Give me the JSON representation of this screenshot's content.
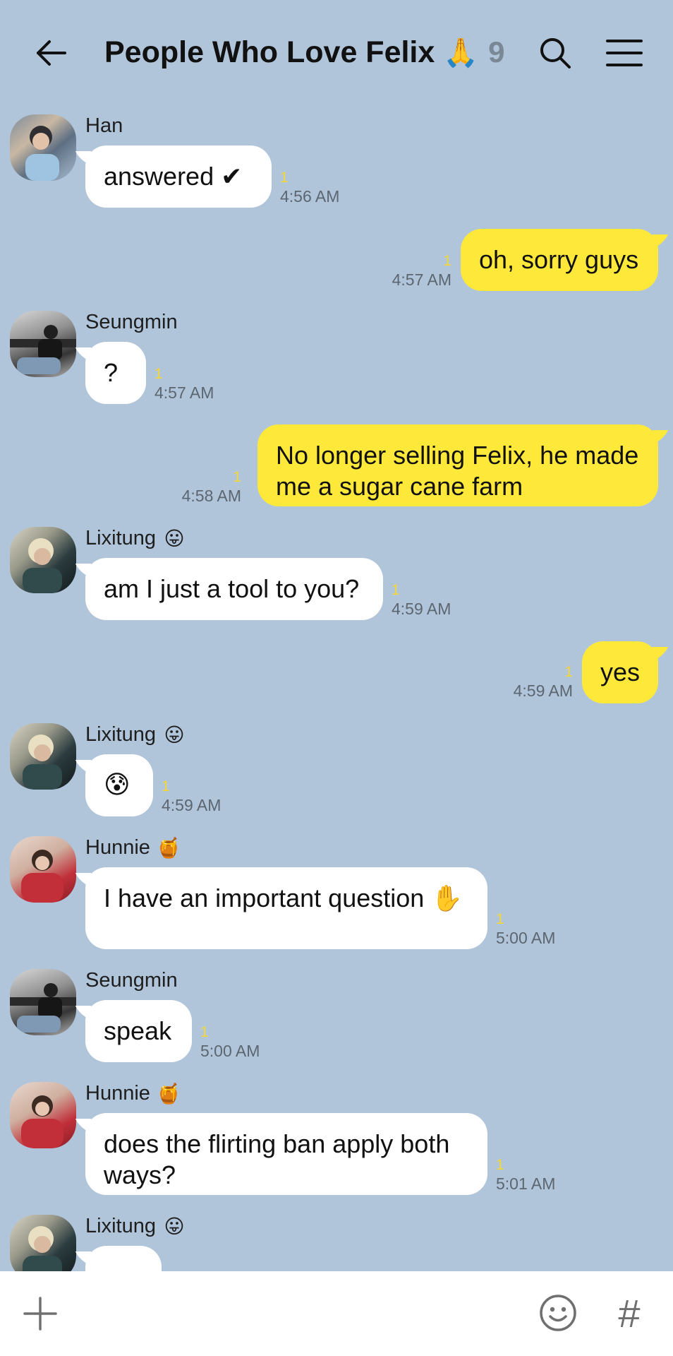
{
  "header": {
    "title": "People Who Love Felix",
    "title_emoji": "🙏",
    "member_count": "9",
    "icons": [
      "back-arrow-icon",
      "search-icon",
      "hamburger-menu-icon"
    ]
  },
  "messages": [
    {
      "sender": "Han",
      "sender_emoji": "",
      "text": "answered ✔",
      "unread": "1",
      "time": "4:56 AM",
      "direction": "in"
    },
    {
      "sender": "",
      "text": "oh, sorry guys",
      "unread": "1",
      "time": "4:57 AM",
      "direction": "out"
    },
    {
      "sender": "Seungmin",
      "sender_emoji": "",
      "text": "?",
      "unread": "1",
      "time": "4:57 AM",
      "direction": "in"
    },
    {
      "sender": "",
      "text": "No longer selling Felix, he made me a sugar cane farm",
      "unread": "1",
      "time": "4:58 AM",
      "direction": "out"
    },
    {
      "sender": "Lixitung",
      "sender_emoji": "😛",
      "text": "am I just a tool to you?",
      "unread": "1",
      "time": "4:59 AM",
      "direction": "in"
    },
    {
      "sender": "",
      "text": "yes",
      "unread": "1",
      "time": "4:59 AM",
      "direction": "out"
    },
    {
      "sender": "Lixitung",
      "sender_emoji": "😛",
      "text": "😰",
      "unread": "1",
      "time": "4:59 AM",
      "direction": "in"
    },
    {
      "sender": "Hunnie",
      "sender_emoji": "🍯",
      "text": "I have an important question ✋",
      "unread": "1",
      "time": "5:00 AM",
      "direction": "in"
    },
    {
      "sender": "Seungmin",
      "sender_emoji": "",
      "text": "speak",
      "unread": "1",
      "time": "5:00 AM",
      "direction": "in"
    },
    {
      "sender": "Hunnie",
      "sender_emoji": "🍯",
      "text": "does the flirting ban apply both ways?",
      "unread": "1",
      "time": "5:01 AM",
      "direction": "in"
    },
    {
      "sender": "Lixitung",
      "sender_emoji": "😛",
      "text": "",
      "unread": "",
      "time": "",
      "direction": "in"
    }
  ],
  "input_bar": {
    "icons": [
      "plus-icon",
      "emoji-icon",
      "hashtag-icon"
    ],
    "hash_label": "#"
  },
  "colors": {
    "background": "#b1c5da",
    "outgoing_bubble": "#fee93a",
    "incoming_bubble": "#ffffff",
    "unread_count": "#f3d637",
    "member_count": "#7a8794"
  }
}
